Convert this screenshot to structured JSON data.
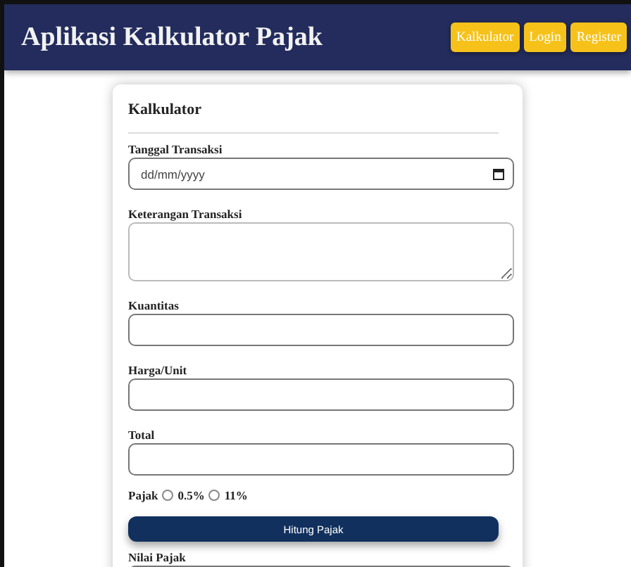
{
  "header": {
    "title": "Aplikasi Kalkulator Pajak",
    "nav": [
      "Kalkulator",
      "Login",
      "Register"
    ]
  },
  "card": {
    "title": "Kalkulator",
    "fields": [
      {
        "label": "Tanggal Transaksi",
        "kind": "date",
        "placeholder": "dd/mm/yyyy"
      },
      {
        "label": "Keterangan Transaksi",
        "kind": "textarea"
      },
      {
        "label": "Kuantitas",
        "kind": "text"
      },
      {
        "label": "Harga/Unit",
        "kind": "text"
      },
      {
        "label": "Total",
        "kind": "text"
      }
    ],
    "tax": {
      "label": "Pajak",
      "options": [
        {
          "label": "0.5%",
          "selected": false
        },
        {
          "label": "11%",
          "selected": false
        }
      ]
    },
    "button": "Hitung Pajak",
    "result": {
      "label": "Nilai Pajak"
    }
  }
}
